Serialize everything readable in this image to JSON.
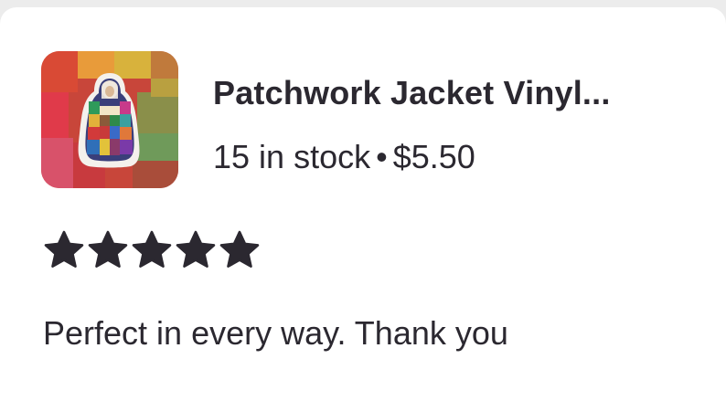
{
  "listing": {
    "title": "Patchwork Jacket Vinyl...",
    "stock": "15 in stock",
    "separator": "•",
    "price": "$5.50",
    "thumbnail_icon": "patchwork-jacket-sticker-thumbnail"
  },
  "review": {
    "rating": 5,
    "rating_max": 5,
    "star_color": "#2b2830",
    "text": "Perfect in every way. Thank you"
  }
}
